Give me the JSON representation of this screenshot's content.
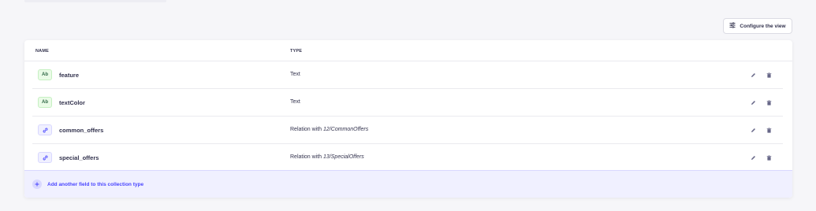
{
  "toolbar": {
    "configure_label": "Configure the view",
    "configure_icon": "sliders-icon"
  },
  "table": {
    "columns": {
      "name": "NAME",
      "type": "TYPE"
    },
    "rows": [
      {
        "badge": "Ab",
        "badge_kind": "text",
        "name": "feature",
        "type_prefix": "Text",
        "type_target": ""
      },
      {
        "badge": "Ab",
        "badge_kind": "text",
        "name": "textColor",
        "type_prefix": "Text",
        "type_target": ""
      },
      {
        "badge": "",
        "badge_kind": "relation",
        "name": "common_offers",
        "type_prefix": "Relation with ",
        "type_target": "12/CommonOffers"
      },
      {
        "badge": "",
        "badge_kind": "relation",
        "name": "special_offers",
        "type_prefix": "Relation with ",
        "type_target": "13/SpecialOffers"
      }
    ],
    "row_actions": [
      "pencil-icon",
      "trash-icon"
    ]
  },
  "add_field": {
    "label": "Add another field to this collection type",
    "icon": "plus-icon"
  },
  "colors": {
    "accent": "#4945ff",
    "text_badge_bg": "#eafbe7",
    "relation_badge_bg": "#f0f0ff",
    "background": "#f6f6f9"
  }
}
